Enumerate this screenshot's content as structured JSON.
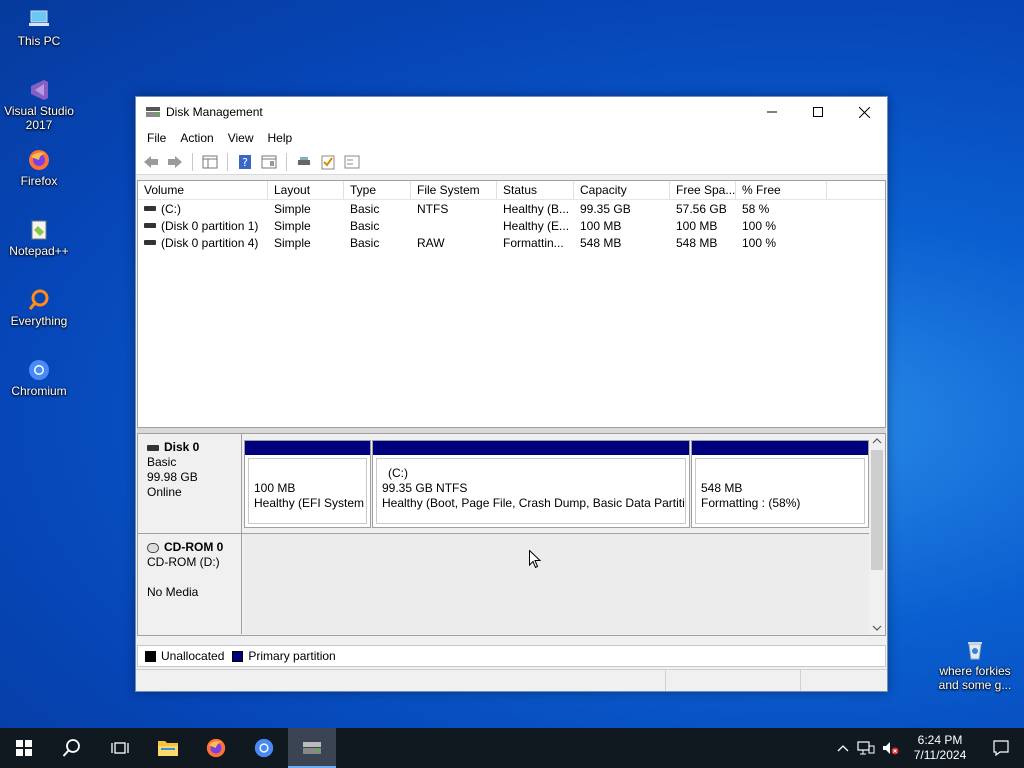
{
  "desktop": {
    "icons": [
      {
        "label": "This PC",
        "icon": "this-pc-icon"
      },
      {
        "label": "Visual Studio 2017",
        "icon": "visual-studio-icon"
      },
      {
        "label": "Firefox",
        "icon": "firefox-icon"
      },
      {
        "label": "Notepad++",
        "icon": "notepad-plus-plus-icon"
      },
      {
        "label": "Everything",
        "icon": "everything-search-icon"
      },
      {
        "label": "Chromium",
        "icon": "chromium-icon"
      }
    ],
    "recycle_bin": {
      "line1": "where forkies",
      "line2": "and some g...",
      "icon": "recycle-bin-icon"
    }
  },
  "window": {
    "title": "Disk Management",
    "menu": [
      "File",
      "Action",
      "View",
      "Help"
    ]
  },
  "volumes": {
    "columns": [
      "Volume",
      "Layout",
      "Type",
      "File System",
      "Status",
      "Capacity",
      "Free Spa...",
      "% Free"
    ],
    "rows": [
      {
        "volume": "(C:)",
        "layout": "Simple",
        "type": "Basic",
        "fs": "NTFS",
        "status": "Healthy (B...",
        "capacity": "99.35 GB",
        "free": "57.56 GB",
        "pct": "58 %"
      },
      {
        "volume": "(Disk 0 partition 1)",
        "layout": "Simple",
        "type": "Basic",
        "fs": "",
        "status": "Healthy (E...",
        "capacity": "100 MB",
        "free": "100 MB",
        "pct": "100 %"
      },
      {
        "volume": "(Disk 0 partition 4)",
        "layout": "Simple",
        "type": "Basic",
        "fs": "RAW",
        "status": "Formattin...",
        "capacity": "548 MB",
        "free": "548 MB",
        "pct": "100 %"
      }
    ]
  },
  "disks": {
    "disk0": {
      "name": "Disk 0",
      "type": "Basic",
      "size": "99.98 GB",
      "state": "Online",
      "partitions": [
        {
          "title": "",
          "line1": "100 MB",
          "line2": "Healthy (EFI System P"
        },
        {
          "title": "(C:)",
          "line1": "99.35 GB NTFS",
          "line2": "Healthy (Boot, Page File, Crash Dump, Basic Data Partition"
        },
        {
          "title": "",
          "line1": "548 MB",
          "line2": "Formatting : (58%)"
        }
      ]
    },
    "cdrom0": {
      "name": "CD-ROM 0",
      "drive": "CD-ROM (D:)",
      "media": "No Media"
    }
  },
  "legend": {
    "unallocated": "Unallocated",
    "primary": "Primary partition",
    "unallocated_color": "#000000",
    "primary_color": "#00007f"
  },
  "taskbar": {
    "time": "6:24 PM",
    "date": "7/11/2024"
  }
}
